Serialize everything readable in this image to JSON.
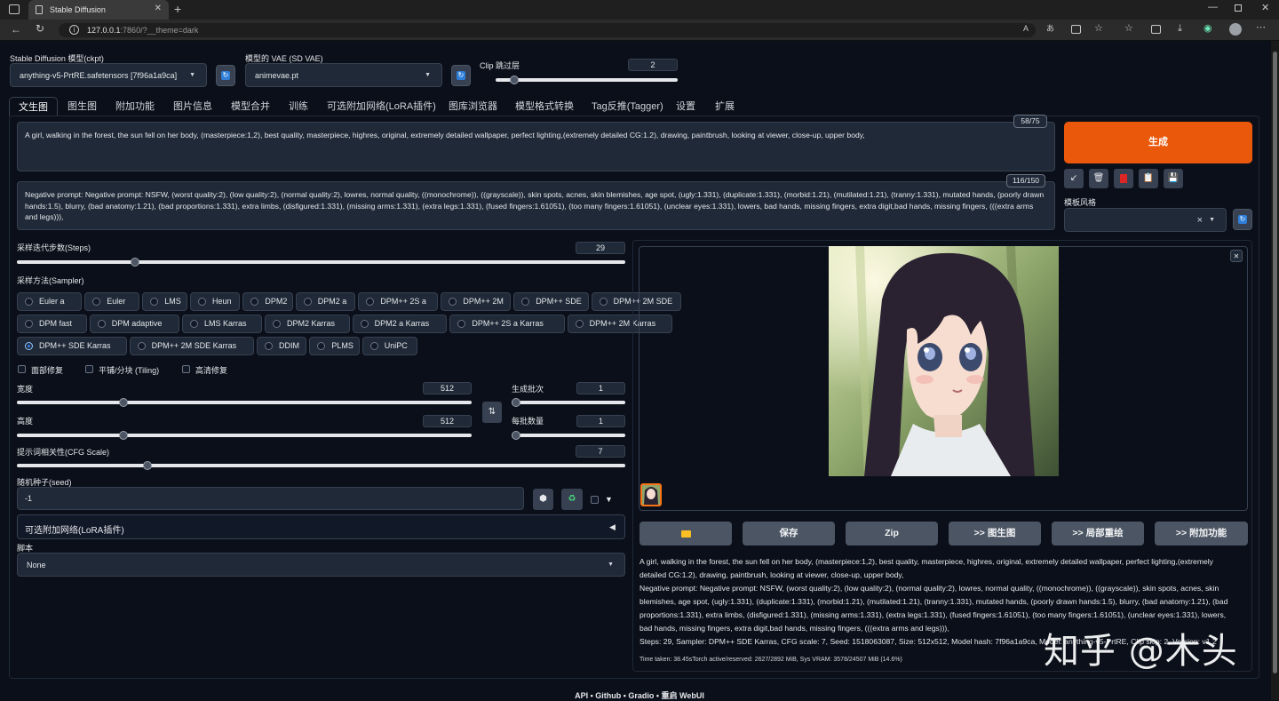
{
  "browser": {
    "tab_title": "Stable Diffusion",
    "url_host": "127.0.0.1",
    "url_rest": ":7860/?__theme=dark"
  },
  "top": {
    "ckpt_label": "Stable Diffusion 模型(ckpt)",
    "ckpt_value": "anything-v5-PrtRE.safetensors [7f96a1a9ca]",
    "vae_label": "模型的 VAE (SD VAE)",
    "vae_value": "animevae.pt",
    "clip_label": "Clip 跳过层",
    "clip_value": "2",
    "clip_fraction": 0.0833
  },
  "tabs": [
    "文生图",
    "图生图",
    "附加功能",
    "图片信息",
    "模型合并",
    "训练",
    "可选附加网络(LoRA插件)",
    "图库浏览器",
    "模型格式转换",
    "Tag反推(Tagger)",
    "设置",
    "扩展"
  ],
  "prompt": {
    "text": "A girl, walking in the forest, the sun fell on her body, (masterpiece:1,2), best quality, masterpiece, highres, original, extremely detailed wallpaper, perfect lighting,(extremely detailed CG:1.2), drawing, paintbrush, looking at viewer, close-up, upper body,",
    "counter": "58/75"
  },
  "negative": {
    "text": "Negative prompt: Negative prompt: NSFW, (worst quality:2), (low quality:2), (normal quality:2), lowres, normal quality, ((monochrome)), ((grayscale)), skin spots, acnes, skin blemishes, age spot, (ugly:1.331), (duplicate:1.331), (morbid:1.21), (mutilated:1.21), (tranny:1.331), mutated hands, (poorly drawn hands:1.5), blurry, (bad anatomy:1.21), (bad proportions:1.331), extra limbs, (disfigured:1.331), (missing arms:1.331), (extra legs:1.331), (fused fingers:1.61051), (too many fingers:1.61051), (unclear eyes:1.331), lowers, bad hands, missing fingers, extra digit,bad hands, missing fingers, (((extra arms and legs))),",
    "counter": "116/150"
  },
  "generate": {
    "label": "生成",
    "style_label": "模板风格",
    "style_clear": "×",
    "small_buttons": [
      "↙",
      "🗑",
      "▣",
      "📋",
      "💾"
    ]
  },
  "steps": {
    "label": "采样迭代步数(Steps)",
    "value": "29",
    "fraction": 0.19
  },
  "sampler": {
    "label": "采样方法(Sampler)",
    "rows": [
      [
        "Euler a",
        "Euler",
        "LMS",
        "Heun",
        "DPM2",
        "DPM2 a",
        "DPM++ 2S a",
        "DPM++ 2M",
        "DPM++ SDE",
        "DPM++ 2M SDE"
      ],
      [
        "DPM fast",
        "DPM adaptive",
        "LMS Karras",
        "DPM2 Karras",
        "DPM2 a Karras",
        "DPM++ 2S a Karras",
        "DPM++ 2M Karras"
      ],
      [
        "DPM++ SDE Karras",
        "DPM++ 2M SDE Karras",
        "DDIM",
        "PLMS",
        "UniPC"
      ]
    ],
    "selected": "DPM++ SDE Karras"
  },
  "checks": {
    "face": "面部修复",
    "tiling": "平铺/分块 (Tiling)",
    "hires": "高清修复"
  },
  "size": {
    "width_label": "宽度",
    "width_value": "512",
    "width_fraction": 0.23,
    "height_label": "高度",
    "height_value": "512",
    "height_fraction": 0.23,
    "swap_icon": "⇅"
  },
  "batch": {
    "count_label": "生成批次",
    "count_value": "1",
    "count_fraction": 0.0,
    "size_label": "每批数量",
    "size_value": "1",
    "size_fraction": 0.0
  },
  "cfg": {
    "label": "提示词相关性(CFG Scale)",
    "value": "7",
    "fraction": 0.21
  },
  "seed": {
    "label": "随机种子(seed)",
    "value": "-1",
    "dice_icon": "⬢",
    "recycle_icon": "♻",
    "extra_icon": "▼"
  },
  "lora": {
    "label": "可选附加网络(LoRA插件)",
    "arrow": "◀"
  },
  "script": {
    "label": "脚本",
    "value": "None"
  },
  "output": {
    "close_icon": "✕",
    "buttons": [
      "📁",
      "保存",
      "Zip",
      ">> 图生图",
      ">> 局部重绘",
      ">> 附加功能"
    ],
    "info_prompt": "A girl, walking in the forest, the sun fell on her body, (masterpiece:1,2), best quality, masterpiece, highres, original, extremely detailed wallpaper, perfect lighting,(extremely detailed CG:1.2), drawing, paintbrush, looking at viewer, close-up, upper body,",
    "info_negative": "Negative prompt: Negative prompt: NSFW, (worst quality:2), (low quality:2), (normal quality:2), lowres, normal quality, ((monochrome)), ((grayscale)), skin spots, acnes, skin blemishes, age spot, (ugly:1.331), (duplicate:1.331), (morbid:1.21), (mutilated:1.21), (tranny:1.331), mutated hands, (poorly drawn hands:1.5), blurry, (bad anatomy:1.21), (bad proportions:1.331), extra limbs, (disfigured:1.331), (missing arms:1.331), (extra legs:1.331), (fused fingers:1.61051), (too many fingers:1.61051), (unclear eyes:1.331), lowers, bad hands, missing fingers, extra digit,bad hands, missing fingers, (((extra arms and legs))),",
    "info_params": "Steps: 29, Sampler: DPM++ SDE Karras, CFG scale: 7, Seed: 1518063087, Size: 512x512, Model hash: 7f96a1a9ca, Model: anything-v5-PrtRE, Clip skip: 2, Version: v1.2",
    "time": "Time taken: 38.45sTorch active/reserved: 2627/2892 MiB, Sys VRAM: 3578/24507 MiB (14.6%)"
  },
  "footer": "API  •  Github  •  Gradio  •  重启 WebUI",
  "watermark": "知乎 @木头",
  "colors": {
    "accent": "#ea580c",
    "panel": "#1f2937",
    "bg": "#0b0f19",
    "selected": "#3b82f6"
  }
}
